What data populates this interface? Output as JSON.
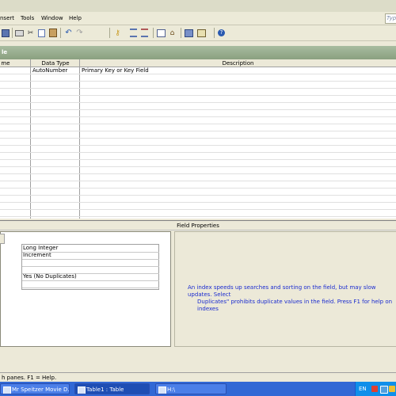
{
  "menubar": {
    "items": [
      "nsert",
      "Tools",
      "Window",
      "Help"
    ],
    "help_placeholder": "Typ"
  },
  "toolbar": {
    "icons": [
      "save-icon",
      "print-icon",
      "preview-icon",
      "cut-icon",
      "copy-icon",
      "paste-icon",
      "undo-icon",
      "redo-icon",
      "primary-key-icon",
      "insert-rows-icon",
      "delete-rows-icon",
      "properties-icon",
      "build-icon",
      "database-window-icon",
      "new-object-icon",
      "help-icon"
    ]
  },
  "window": {
    "title": "le"
  },
  "design_grid": {
    "columns": [
      "me",
      "Data Type",
      "Description"
    ],
    "rows": [
      {
        "name": "",
        "data_type": "AutoNumber",
        "description": "Primary Key or Key Field"
      }
    ]
  },
  "field_properties": {
    "header": "Field Properties",
    "values": [
      "Long Integer",
      "Increment",
      "",
      "",
      "Yes (No Duplicates)",
      ""
    ],
    "hint_line1": "An index speeds up searches and sorting on the field, but may slow updates.  Select",
    "hint_line2": "Duplicates\" prohibits duplicate values in the field.  Press F1 for help on indexes"
  },
  "statusbar": {
    "text": "h panes.  F1 = Help."
  },
  "taskbar": {
    "tasks": [
      "Mr Speitzer Movie D...",
      "Table1 : Table",
      "H:\\"
    ],
    "language": "EN"
  },
  "colors": {
    "taskbar": "#3168d5",
    "hint_text": "#1a2bd0",
    "titlebar": "#8aa080"
  }
}
